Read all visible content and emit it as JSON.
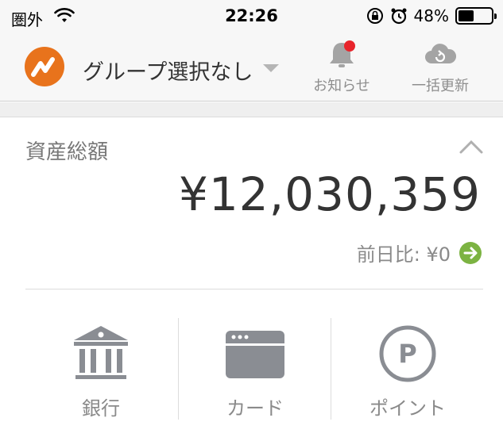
{
  "status_bar": {
    "carrier": "圏外",
    "time": "22:26",
    "battery_percent": "48%",
    "battery_level": 0.48
  },
  "nav": {
    "group_title": "グループ選択なし",
    "notice_label": "お知らせ",
    "refresh_label": "一括更新",
    "logo_color": "#e8731c",
    "badge_color": "#e8242b"
  },
  "assets": {
    "title": "資産総額",
    "amount": "¥12,030,359",
    "diff_label": "前日比: ¥0",
    "diff_icon_color": "#7cb342"
  },
  "categories": [
    {
      "label": "銀行",
      "icon": "bank-icon"
    },
    {
      "label": "カード",
      "icon": "card-icon"
    },
    {
      "label": "ポイント",
      "icon": "point-icon"
    }
  ]
}
